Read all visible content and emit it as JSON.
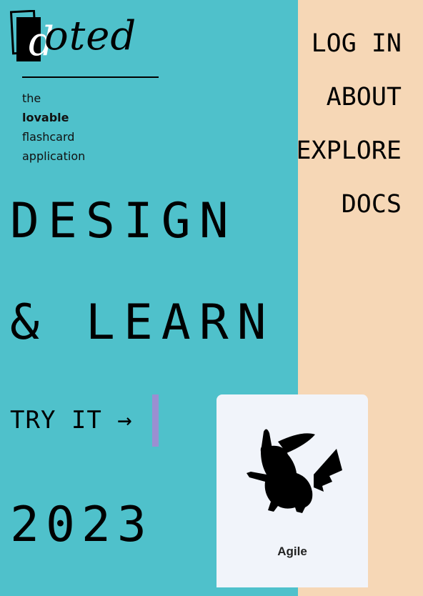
{
  "brand": {
    "logo_letter": "d",
    "logo_rest": "oted",
    "tagline": [
      "the",
      "lovable",
      "flashcard",
      "application"
    ]
  },
  "hero": {
    "line1": "DESIGN",
    "line2": "& LEARN",
    "cta": "TRY IT →",
    "year": "2023"
  },
  "nav": {
    "items": [
      "LOG IN",
      "ABOUT",
      "EXPLORE",
      "DOCS"
    ]
  },
  "card": {
    "label": "Agile",
    "image_icon": "pikachu-silhouette-icon"
  },
  "colors": {
    "background": "#4fc1cb",
    "side_panel": "#f6d7b6",
    "accent_bar": "#9b8fd1",
    "card": "#f1f4fa"
  }
}
